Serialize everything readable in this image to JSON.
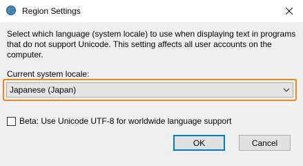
{
  "window": {
    "title": "Region Settings",
    "app_icon": "globe-icon",
    "close_icon": "close-icon"
  },
  "description": "Select which language (system locale) to use when displaying text in programs that do not support Unicode. This setting affects all user accounts on the computer.",
  "locale": {
    "label": "Current system locale:",
    "selected_value": "Japanese (Japan)",
    "highlight_color": "#e8891b"
  },
  "beta": {
    "label": "Beta: Use Unicode UTF-8 for worldwide language support",
    "checked": false
  },
  "buttons": {
    "ok_label": "OK",
    "cancel_label": "Cancel"
  }
}
